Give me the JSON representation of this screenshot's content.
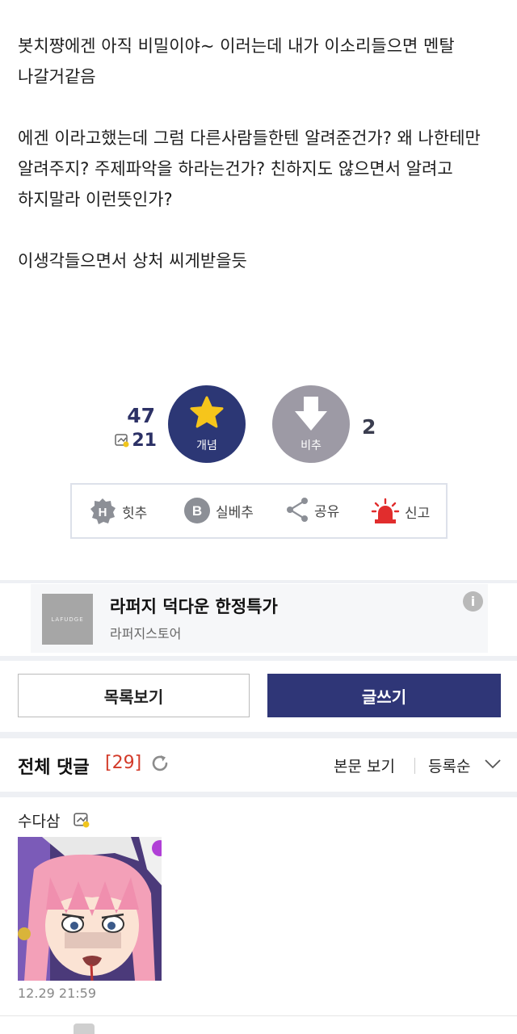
{
  "post": {
    "paragraphs": [
      "봇치쨩에겐 아직 비밀이야~ 이러는데 내가 이소리들으면 멘탈 나갈거같음",
      "에겐 이라고했는데 그럼 다른사람들한텐 알려준건가? 왜 나한테만 알려주지? 주제파악을 하라는건가? 친하지도 않으면서 알려고 하지말라 이런뜻인가?",
      "이생각들으면서 상처 씨게받을듯"
    ]
  },
  "vote": {
    "up_count": "47",
    "fixed_count": "21",
    "up_label": "개념",
    "down_label": "비추",
    "down_count": "2"
  },
  "actions": [
    {
      "label": "힛추",
      "icon": "hit-icon"
    },
    {
      "label": "실베추",
      "icon": "b-icon"
    },
    {
      "label": "공유",
      "icon": "share-icon"
    },
    {
      "label": "신고",
      "icon": "siren-icon"
    }
  ],
  "ad": {
    "logo_text": "LAFUDGE",
    "title": "라퍼지 덕다운 한정특가",
    "subtitle": "라퍼지스토어",
    "info_icon": "i"
  },
  "buttons": {
    "list": "목록보기",
    "write": "글쓰기"
  },
  "comments_header": {
    "title": "전체 댓글",
    "count": "[29]",
    "view_label": "본문 보기",
    "sort_label": "등록순"
  },
  "comments": [
    {
      "author": "수다삼",
      "time": "12.29 21:59"
    }
  ],
  "colors": {
    "accent": "#2c3775",
    "downvote": "#9d9aa5",
    "count_red": "#d33b2a"
  }
}
